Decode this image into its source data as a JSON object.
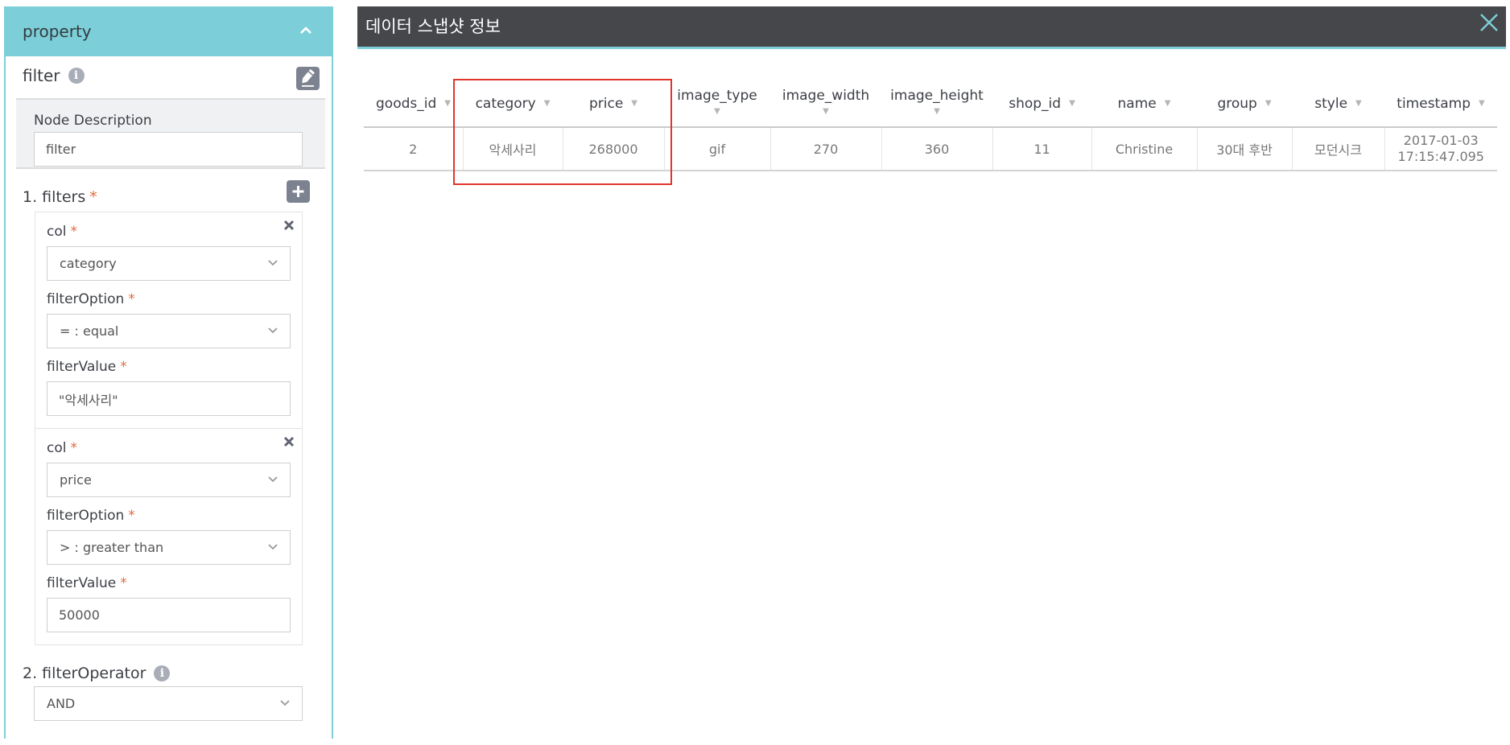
{
  "panel": {
    "title": "property",
    "node": {
      "name": "filter",
      "description_label": "Node Description",
      "description_value": "filter"
    },
    "filters_section": {
      "title": "1. filters",
      "required_mark": "*",
      "items": [
        {
          "col_label": "col",
          "col_value": "category",
          "option_label": "filterOption",
          "option_value": "= : equal",
          "value_label": "filterValue",
          "value": "\"악세사리\""
        },
        {
          "col_label": "col",
          "col_value": "price",
          "option_label": "filterOption",
          "option_value": "> : greater than",
          "value_label": "filterValue",
          "value": "50000"
        }
      ]
    },
    "operator_section": {
      "title": "2. filterOperator",
      "value": "AND"
    },
    "icons": {
      "collapse": "chevron-up-icon",
      "info": "info-icon",
      "edit": "pencil-icon",
      "add": "plus-icon",
      "remove": "close-icon",
      "dropdown": "chevron-down-icon"
    },
    "colors": {
      "accent": "#7ccfd8",
      "required": "#e46a3b",
      "button": "#7d8290"
    }
  },
  "modal": {
    "title": "데이터 스냅샷 정보",
    "colors": {
      "header_bg": "#46474b",
      "accent": "#7ccfd8",
      "highlight": "#e0362c"
    },
    "table": {
      "columns": [
        "goods_id",
        "category",
        "price",
        "image_type",
        "image_width",
        "image_height",
        "shop_id",
        "name",
        "group",
        "style",
        "timestamp"
      ],
      "rows": [
        {
          "goods_id": "2",
          "category": "악세사리",
          "price": "268000",
          "image_type": "gif",
          "image_width": "270",
          "image_height": "360",
          "shop_id": "11",
          "name": "Christine",
          "group": "30대 후반",
          "style": "모던시크",
          "timestamp_date": "2017-01-03",
          "timestamp_time": "17:15:47.095"
        }
      ],
      "highlighted_columns": [
        "category",
        "price"
      ]
    }
  }
}
